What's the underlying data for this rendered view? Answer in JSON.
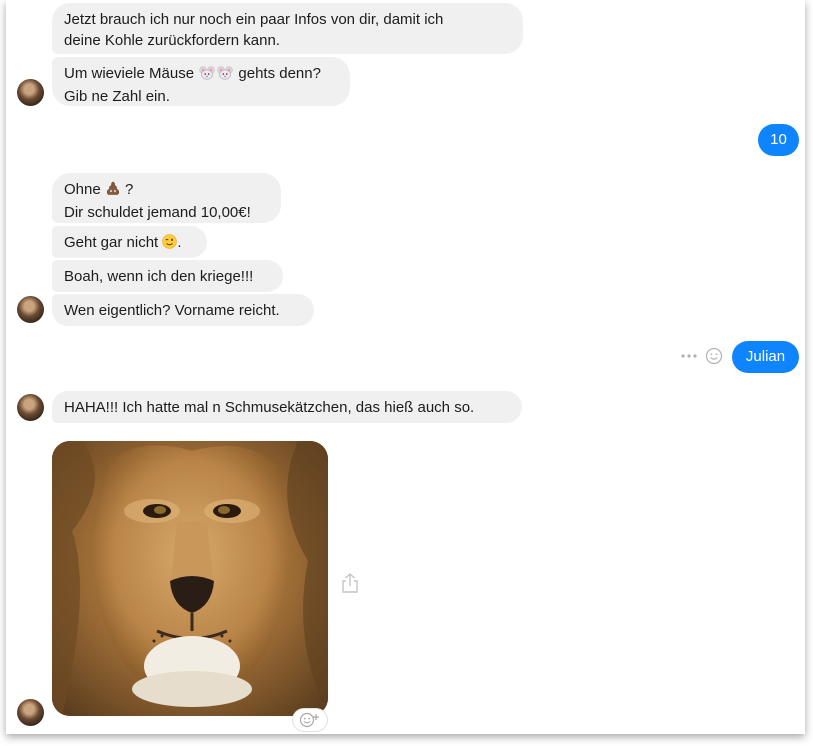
{
  "messages": {
    "m1": {
      "line1": "Jetzt brauch ich nur noch ein paar Infos von dir, damit ich",
      "line2": "deine Kohle zurückfordern kann."
    },
    "m2": {
      "line1_a": "Um wieviele Mäuse",
      "line1_emoji": "mouse-emoji-pair",
      "line1_b": "gehts denn?",
      "line2": "Gib ne Zahl ein."
    },
    "out1": "10",
    "m3": {
      "line1_a": "Ohne",
      "line1_emoji": "pile-of-poo-emoji",
      "line1_b": "?",
      "line2": "Dir schuldet jemand 10,00€!"
    },
    "m4": {
      "text_a": "Geht gar nicht",
      "emoji": "winking-face-emoji",
      "text_b": "."
    },
    "m5": "Boah, wenn ich den kriege!!!",
    "m6": "Wen eigentlich? Vorname reicht.",
    "out2": "Julian",
    "m7": "HAHA!!! Ich hatte mal n Schmusekätzchen, das hieß auch so.",
    "image": {
      "subject": "lion-face-photo"
    }
  },
  "icons": {
    "more": "more-options-icon",
    "react": "smiley-react-icon",
    "share": "share-icon",
    "add_reaction": "add-reaction-icon"
  },
  "colors": {
    "incoming_bubble": "#f0f0f0",
    "outgoing_bubble": "#0f84ff",
    "text": "#1c1c1c"
  }
}
